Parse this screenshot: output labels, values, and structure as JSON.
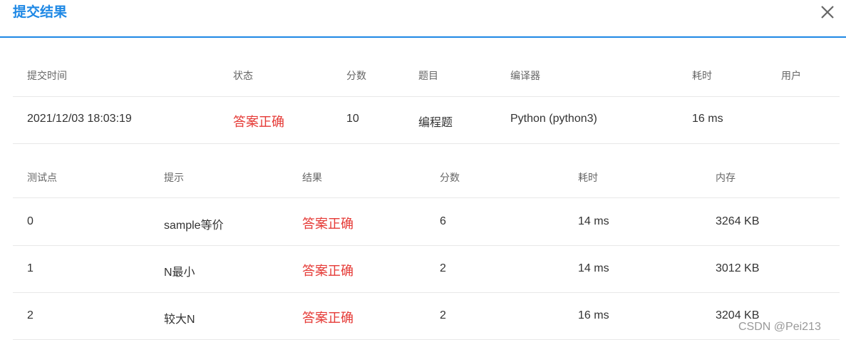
{
  "dialog": {
    "title": "提交结果"
  },
  "summary": {
    "headers": [
      "提交时间",
      "状态",
      "分数",
      "题目",
      "编译器",
      "耗时",
      "用户"
    ],
    "row": {
      "time": "2021/12/03 18:03:19",
      "status": "答案正确",
      "score": "10",
      "problem": "编程题",
      "compiler": "Python (python3)",
      "elapsed": "16 ms",
      "user": ""
    }
  },
  "tests": {
    "headers": [
      "测试点",
      "提示",
      "结果",
      "分数",
      "耗时",
      "内存"
    ],
    "rows": [
      {
        "id": "0",
        "hint": "sample等价",
        "result": "答案正确",
        "score": "6",
        "time": "14 ms",
        "memory": "3264 KB"
      },
      {
        "id": "1",
        "hint": "N最小",
        "result": "答案正确",
        "score": "2",
        "time": "14 ms",
        "memory": "3012 KB"
      },
      {
        "id": "2",
        "hint": "较大N",
        "result": "答案正确",
        "score": "2",
        "time": "16 ms",
        "memory": "3204 KB"
      }
    ]
  },
  "watermark": "CSDN @Pei213",
  "colors": {
    "accent": "#1e88e5",
    "success_text": "#e53935"
  },
  "icons": {
    "close": "close-icon"
  }
}
